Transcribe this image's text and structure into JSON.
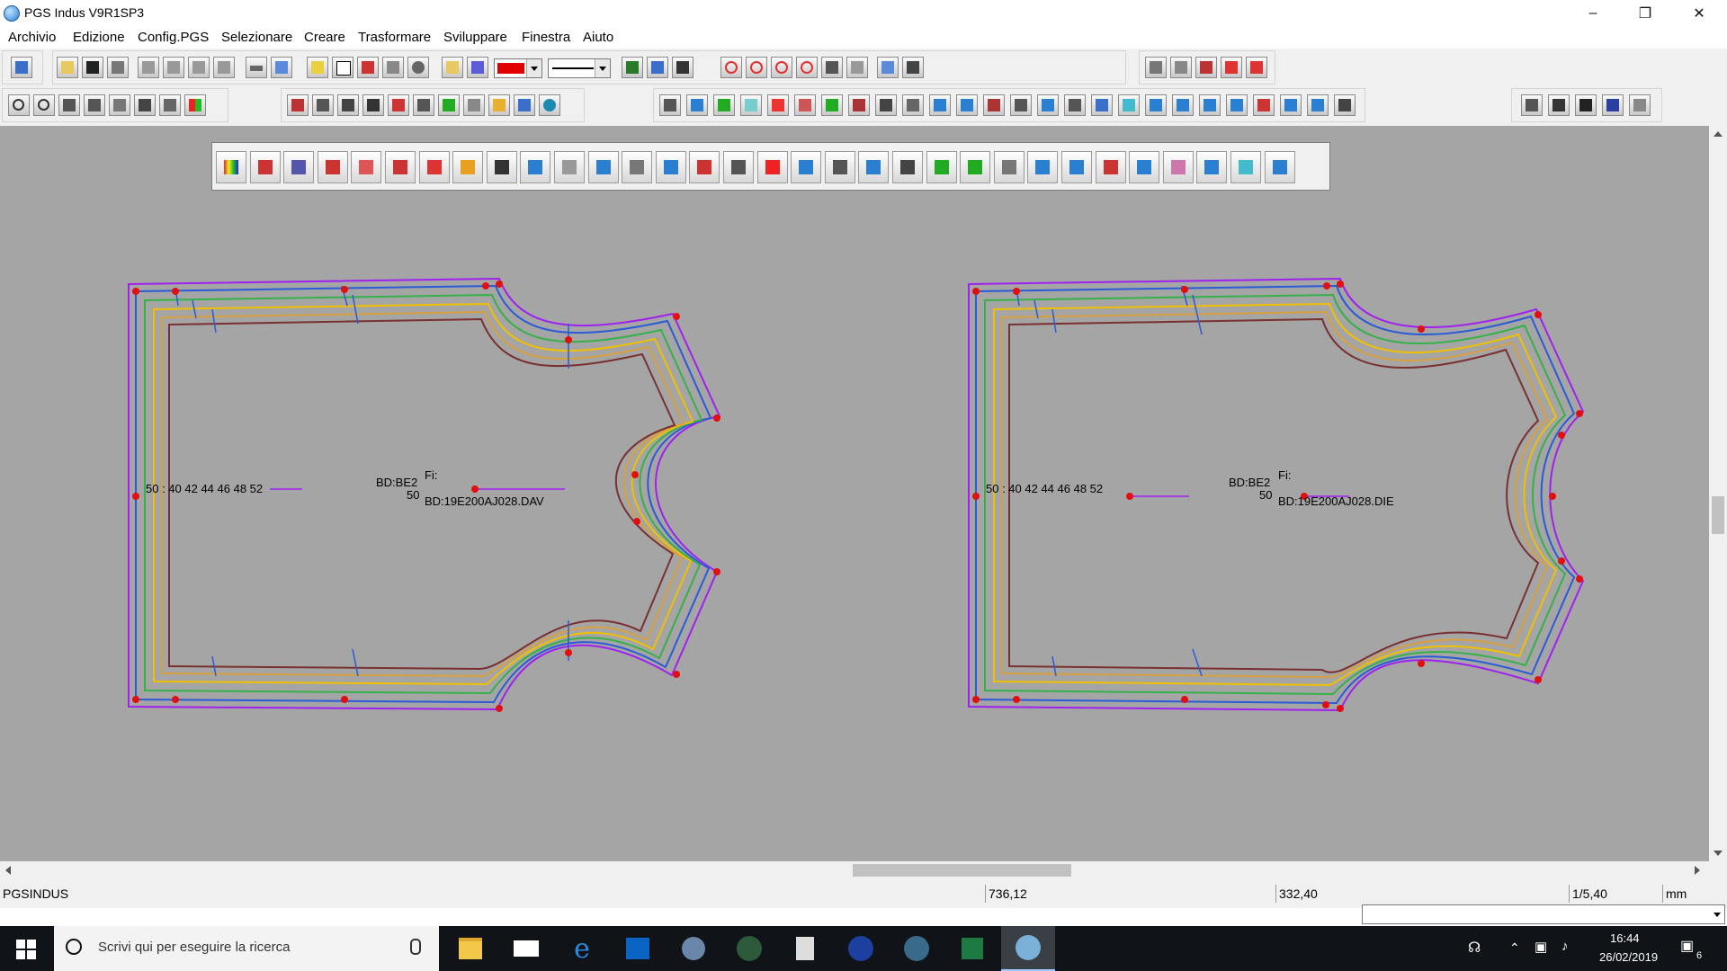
{
  "window": {
    "title": "PGS Indus V9R1SP3"
  },
  "menu": [
    "Archivio",
    "Edizione",
    "Config.PGS",
    "Selezionare",
    "Creare",
    "Trasformare",
    "Sviluppare",
    "Finestra",
    "Aiuto"
  ],
  "toolbar": {
    "color_swatch": "#e00000",
    "line_style": "solid"
  },
  "pieces": [
    {
      "sizes_label": "50 : 40 42 44 46 48 52",
      "ref_label": "BD:BE2",
      "size_value": "50",
      "fi_label": "Fi:",
      "file_label": "BD:19E200AJ028.DAV"
    },
    {
      "sizes_label": "50 : 40 42 44 46 48 52",
      "ref_label": "BD:BE2",
      "size_value": "50",
      "fi_label": "Fi:",
      "file_label": "BD:19E200AJ028.DIE"
    }
  ],
  "grading_colors": [
    "#a020f0",
    "#2a5bd7",
    "#36b04a",
    "#f0c000",
    "#d9a040",
    "#7a3030"
  ],
  "status": {
    "name": "PGSINDUS",
    "x": "736,12",
    "y": "332,40",
    "scale": "1/5,40",
    "unit": "mm"
  },
  "taskbar": {
    "search_placeholder": "Scrivi qui per eseguire la ricerca",
    "time": "16:44",
    "date": "26/02/2019",
    "notifications": "6"
  }
}
